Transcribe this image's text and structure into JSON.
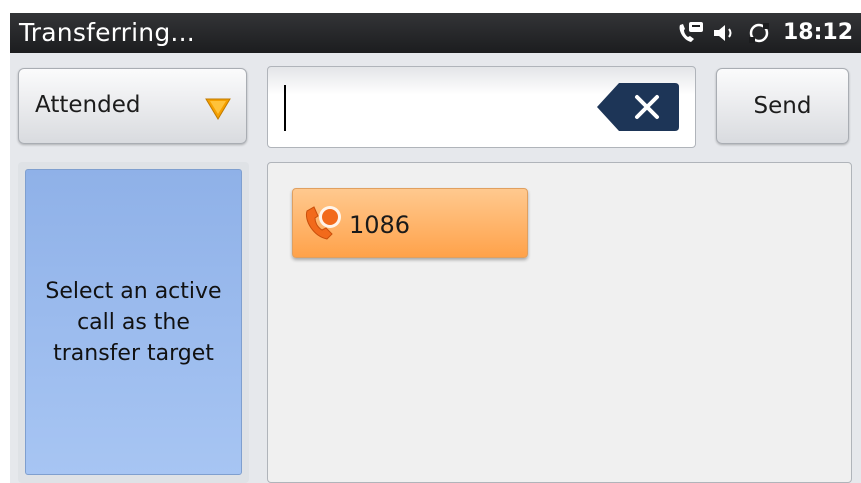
{
  "statusbar": {
    "title": "Transferring...",
    "icons": [
      "call-active-icon",
      "volume-icon",
      "sync-icon"
    ],
    "time": "18:12"
  },
  "transfer": {
    "mode_label": "Attended",
    "input_value": "",
    "send_label": "Send"
  },
  "hint": {
    "text": "Select an active call as the transfer target"
  },
  "calls": [
    {
      "number": "1086",
      "icon": "active-call-icon"
    }
  ],
  "colors": {
    "statusbar": "#1f2022",
    "hint_panel": "#98b8ee",
    "call_item": "#ffb36e",
    "dropdown_arrow": "#f5a000",
    "backspace": "#1d3557"
  }
}
